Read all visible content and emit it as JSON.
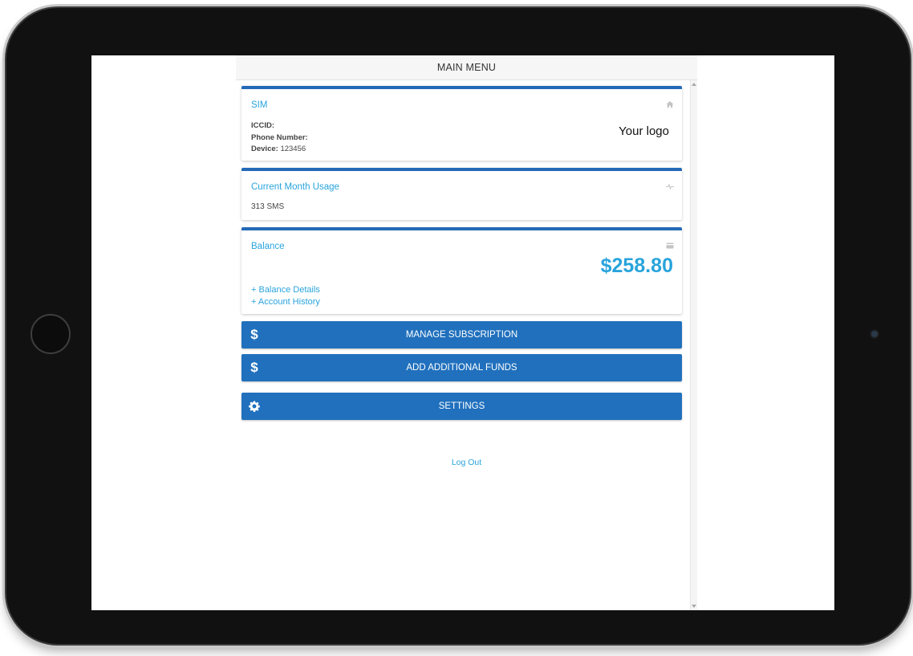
{
  "header": {
    "title": "MAIN MENU"
  },
  "sim": {
    "title": "SIM",
    "icon": "home-icon",
    "iccid_label": "ICCID:",
    "iccid_value": "",
    "phone_label": "Phone Number:",
    "phone_value": "",
    "device_label": "Device:",
    "device_value": "123456",
    "logo_text": "Your logo"
  },
  "usage": {
    "title": "Current Month Usage",
    "icon": "pulse-icon",
    "value": "313 SMS"
  },
  "balance": {
    "title": "Balance",
    "icon": "credit-card-icon",
    "amount": "$258.80",
    "details_link": "+ Balance Details",
    "history_link": "+ Account History"
  },
  "buttons": {
    "manage_subscription": {
      "label": "MANAGE SUBSCRIPTION",
      "icon": "dollar-icon"
    },
    "add_funds": {
      "label": "ADD ADDITIONAL FUNDS",
      "icon": "dollar-icon"
    },
    "settings": {
      "label": "SETTINGS",
      "icon": "gear-icon"
    }
  },
  "footer": {
    "logout": "Log Out"
  },
  "colors": {
    "accent": "#29a4dc",
    "button": "#2070bd",
    "card_border": "#2369b8"
  }
}
